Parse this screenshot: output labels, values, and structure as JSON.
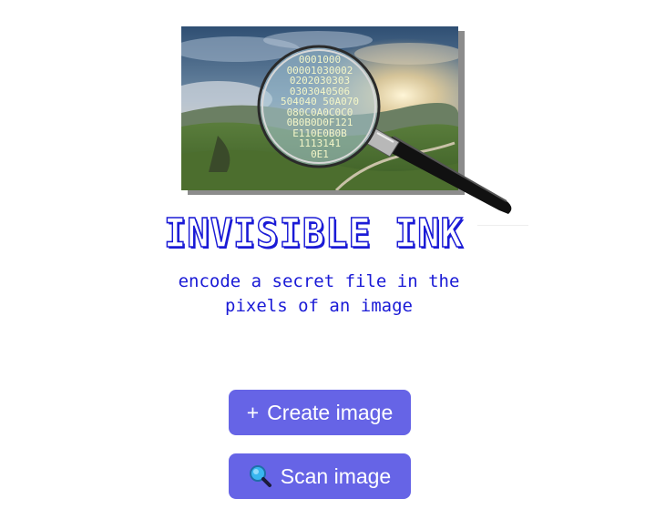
{
  "header": {
    "title": "INVISIBLE INK",
    "subtitle_line1": "encode a secret file in the",
    "subtitle_line2": "pixels of an image"
  },
  "hero": {
    "icon": "magnifying-glass-over-landscape",
    "hex_lines": [
      "0001000",
      "00001030002",
      "0202030303",
      "0303040506",
      "504040 50A070",
      "080C0A0C0C0",
      "0B0B0D0F121",
      "E110E0B0B",
      "1113141",
      "0E1"
    ]
  },
  "actions": {
    "create_icon": "+",
    "create_label": "Create image",
    "scan_icon": "magnifying-glass-icon",
    "scan_label": "Scan image"
  },
  "colors": {
    "accent": "#6664e6",
    "title_blue": "#1b1bd6",
    "subtitle_blue": "#1a1ad6"
  }
}
